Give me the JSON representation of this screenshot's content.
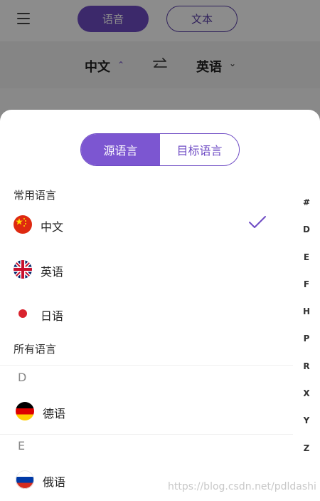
{
  "header": {
    "mode_voice": "语音",
    "mode_text": "文本",
    "source_lang": "中文",
    "target_lang": "英语"
  },
  "sheet": {
    "tabs": [
      {
        "label": "源语言",
        "active": true
      },
      {
        "label": "目标语言",
        "active": false
      }
    ],
    "common_title": "常用语言",
    "common": [
      {
        "label": "中文",
        "flag": "cn-flag-icon",
        "selected": true
      },
      {
        "label": "英语",
        "flag": "uk-flag-icon",
        "selected": false
      },
      {
        "label": "日语",
        "flag": "jp-flag-icon",
        "selected": false
      }
    ],
    "all_title": "所有语言",
    "groups": [
      {
        "letter": "D",
        "items": [
          {
            "label": "德语",
            "flag": "de-flag-icon"
          }
        ]
      },
      {
        "letter": "E",
        "items": [
          {
            "label": "俄语",
            "flag": "ru-flag-icon"
          }
        ]
      }
    ],
    "index": [
      "#",
      "D",
      "E",
      "F",
      "H",
      "P",
      "R",
      "X",
      "Y",
      "Z"
    ]
  },
  "watermark": "https://blog.csdn.net/pdldashi",
  "colors": {
    "accent": "#6e4bc4",
    "accent_light": "#7c56d1"
  }
}
